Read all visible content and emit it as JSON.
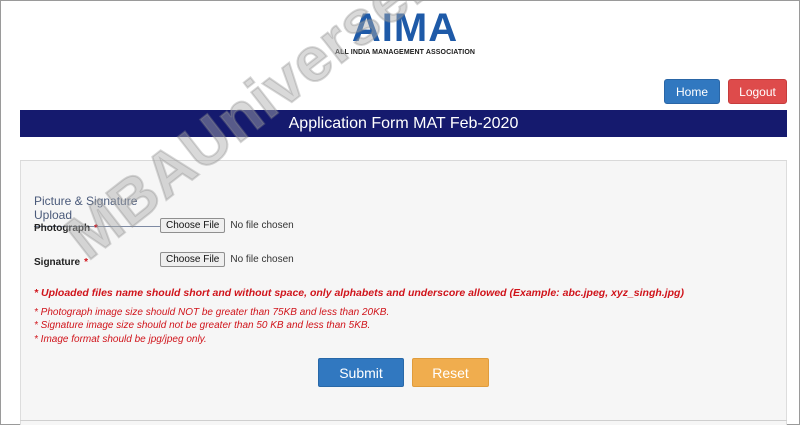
{
  "logo": {
    "mark": "AIMA",
    "tagline": "ALL INDIA MANAGEMENT ASSOCIATION"
  },
  "nav": {
    "home_label": "Home",
    "logout_label": "Logout"
  },
  "page": {
    "title": "Application Form MAT Feb-2020"
  },
  "upload": {
    "section_title": "Picture & Signature Upload",
    "required_marker": "*",
    "fields": [
      {
        "label": "Photograph",
        "button": "Choose File",
        "status": "No file chosen"
      },
      {
        "label": "Signature",
        "button": "Choose File",
        "status": "No file chosen"
      }
    ],
    "main_note": "* Uploaded files name should short and without space, only alphabets and underscore allowed (Example: abc.jpeg, xyz_singh.jpg)",
    "notes": [
      "* Photograph image size should NOT be greater than 75KB and less than 20KB.",
      "* Signature image size should not be greater than 50 KB and less than 5KB.",
      "* Image format should be jpg/jpeg only."
    ],
    "submit_label": "Submit",
    "reset_label": "Reset"
  },
  "watermark": {
    "text": "MBAUniverse.com"
  },
  "colors": {
    "brand_blue": "#1e5aa8",
    "title_bar": "#151a6e",
    "primary_button": "#3178c0",
    "danger_button": "#de4b4b",
    "warning_button": "#f0ad4e",
    "error_text": "#d0141b"
  }
}
